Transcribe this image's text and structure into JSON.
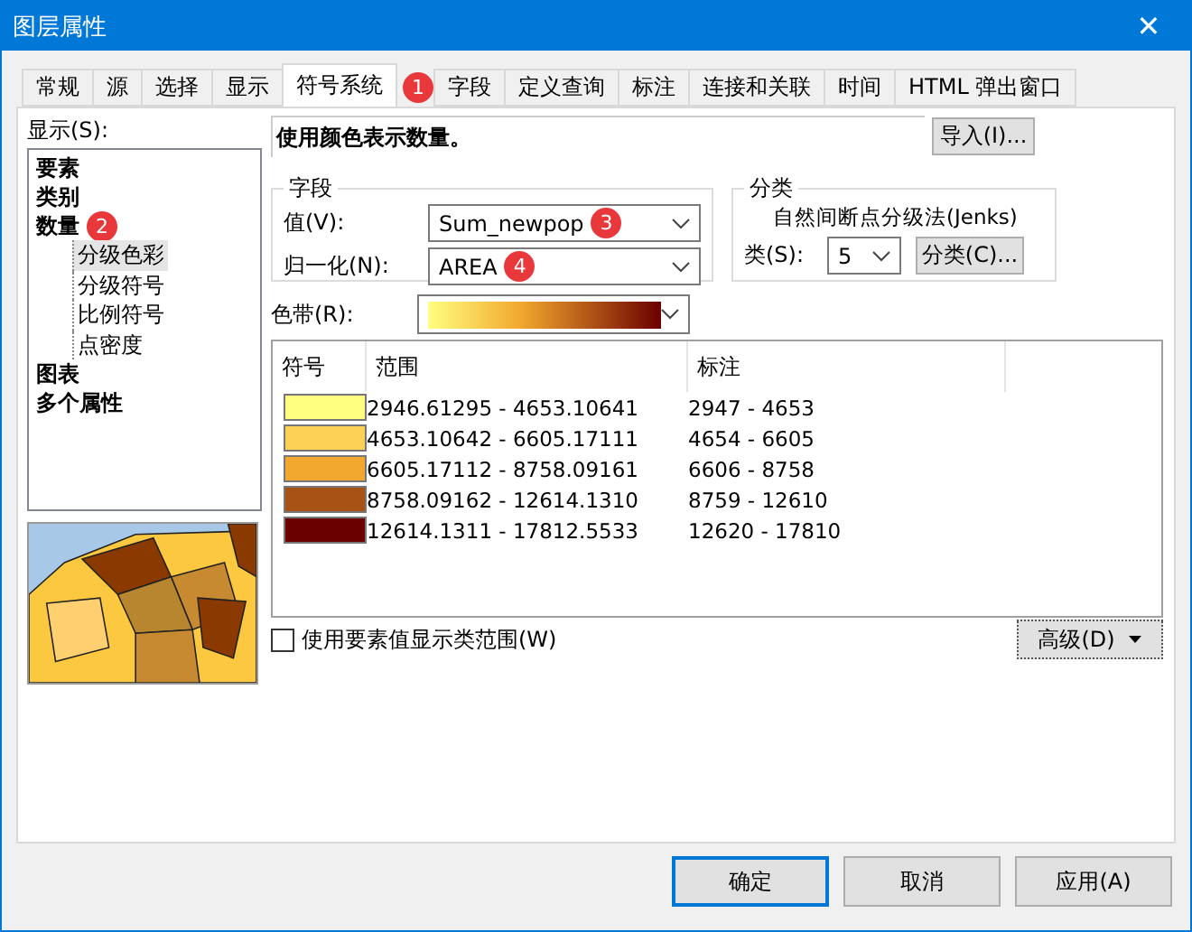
{
  "window": {
    "title": "图层属性",
    "close": "✕"
  },
  "tabs": [
    {
      "label": "常规",
      "selected": false
    },
    {
      "label": "源",
      "selected": false
    },
    {
      "label": "选择",
      "selected": false
    },
    {
      "label": "显示",
      "selected": false
    },
    {
      "label": "符号系统",
      "selected": true
    },
    {
      "label": "字段",
      "selected": false
    },
    {
      "label": "定义查询",
      "selected": false
    },
    {
      "label": "标注",
      "selected": false
    },
    {
      "label": "连接和关联",
      "selected": false
    },
    {
      "label": "时间",
      "selected": false
    },
    {
      "label": "HTML 弹出窗口",
      "selected": false
    }
  ],
  "show_label": "显示(S):",
  "tree": [
    {
      "label": "要素",
      "selected": false
    },
    {
      "label": "类别",
      "selected": false
    },
    {
      "label": "数量",
      "selected": false,
      "children": [
        {
          "label": "分级色彩",
          "selected": true
        },
        {
          "label": "分级符号",
          "selected": false
        },
        {
          "label": "比例符号",
          "selected": false
        },
        {
          "label": "点密度",
          "selected": false
        }
      ]
    },
    {
      "label": "图表",
      "selected": false
    },
    {
      "label": "多个属性",
      "selected": false
    }
  ],
  "description": "使用颜色表示数量。",
  "import_button": "导入(I)...",
  "field_group": {
    "title": "字段",
    "value_label": "值(V):",
    "value": "Sum_newpop",
    "normalize_label": "归一化(N):",
    "normalize": "AREA"
  },
  "classify_group": {
    "title": "分类",
    "method": "自然间断点分级法(Jenks)",
    "classes_label": "类(S):",
    "classes": "5",
    "button": "分类(C)..."
  },
  "color_ramp_label": "色带(R):",
  "table": {
    "columns": [
      "符号",
      "范围",
      "标注"
    ],
    "rows": [
      {
        "color": "#ffff80",
        "range": "2946.61295 - 4653.10641",
        "label": "2947 - 4653"
      },
      {
        "color": "#fcd155",
        "range": "4653.10642 - 6605.17111",
        "label": "4654 - 6605"
      },
      {
        "color": "#f2a72e",
        "range": "6605.17112 - 8758.09161",
        "label": "6606 - 8758"
      },
      {
        "color": "#a85315",
        "range": "8758.09162 - 12614.1310",
        "label": "8759 - 12610"
      },
      {
        "color": "#6b0000",
        "range": "12614.1311 - 17812.5533",
        "label": "12620 - 17810"
      }
    ]
  },
  "show_class_ranges": {
    "label": "使用要素值显示类范围(W)",
    "checked": false
  },
  "advanced_button": "高级(D)",
  "buttons": [
    {
      "label": "确定",
      "default": true
    },
    {
      "label": "取消",
      "default": false
    },
    {
      "label": "应用(A)",
      "default": false
    }
  ],
  "markers": [
    "1",
    "2",
    "3",
    "4"
  ]
}
